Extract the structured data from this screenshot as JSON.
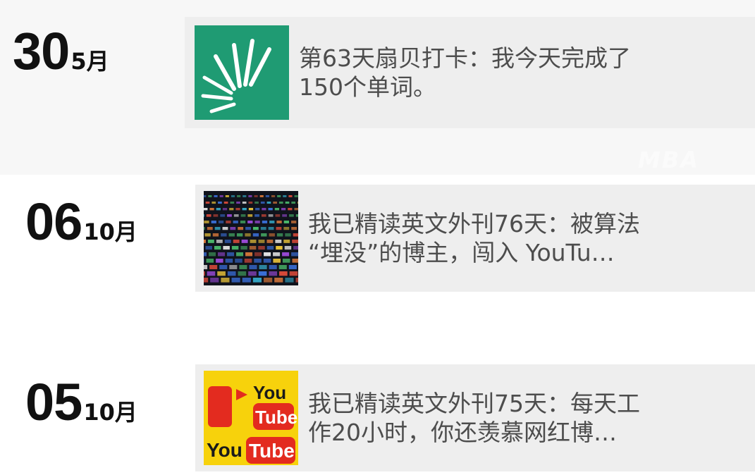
{
  "entries": [
    {
      "day": "30",
      "month": "5月",
      "text": "第63天扇贝打卡：我今天完成了\n150个单词。",
      "thumbnail_icon": "shanbay-logo-icon",
      "thumbnail_bg": "#1f9b73"
    },
    {
      "day": "06",
      "month": "10月",
      "text": "我已精读英文外刊76天：被算法\n“埋没”的博主，闯入 YouTu…",
      "thumbnail_icon": "video-wall-icon",
      "thumbnail_bg": "#10131c"
    },
    {
      "day": "05",
      "month": "10月",
      "text": "我已精读英文外刊75天：每天工\n作20小时，你还羡慕网红博…",
      "thumbnail_icon": "youtube-logo-icon",
      "thumbnail_bg": "#f7d20c",
      "logo_text_you": "You",
      "logo_text_tube": "Tube"
    }
  ]
}
